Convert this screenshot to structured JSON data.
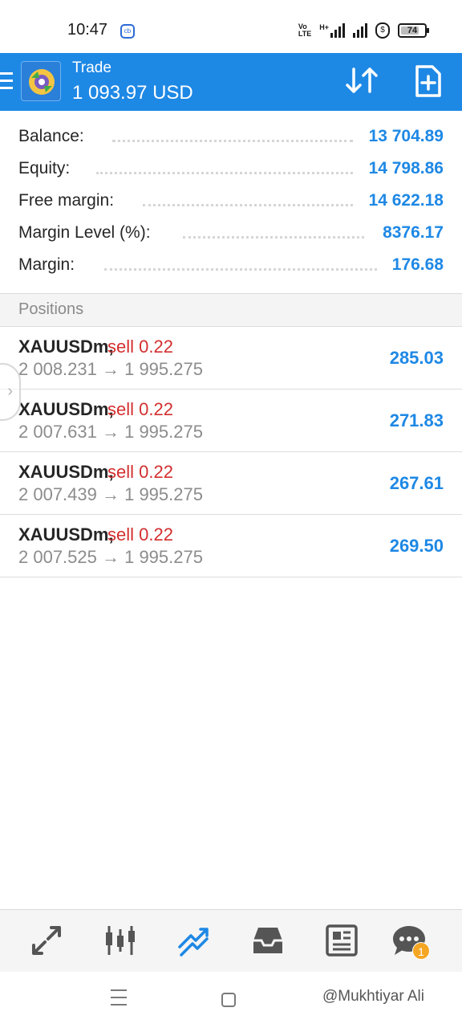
{
  "status_bar": {
    "time": "10:47",
    "badge": "cb",
    "network_label_top": "Vo",
    "network_label_bottom": "LTE",
    "network_type": "H+",
    "battery": "74"
  },
  "app_bar": {
    "title": "Trade",
    "subtitle": "1 093.97 USD",
    "accent_color": "#1e88e5"
  },
  "summary": [
    {
      "label": "Balance:",
      "value": "13 704.89"
    },
    {
      "label": "Equity:",
      "value": "14 798.86"
    },
    {
      "label": "Free margin:",
      "value": "14 622.18"
    },
    {
      "label": "Margin Level (%):",
      "value": "8376.17"
    },
    {
      "label": "Margin:",
      "value": "176.68"
    }
  ],
  "positions_header": "Positions",
  "positions": [
    {
      "symbol": "XAUUSDm,",
      "side": "sell 0.22",
      "prices": "2 008.231 → 1 995.275",
      "profit": "285.03"
    },
    {
      "symbol": "XAUUSDm,",
      "side": "sell 0.22",
      "prices": "2 007.631 → 1 995.275",
      "profit": "271.83"
    },
    {
      "symbol": "XAUUSDm,",
      "side": "sell 0.22",
      "prices": "2 007.439 → 1 995.275",
      "profit": "267.61"
    },
    {
      "symbol": "XAUUSDm,",
      "side": "sell 0.22",
      "prices": "2 007.525 → 1 995.275",
      "profit": "269.50"
    }
  ],
  "bottom_nav": {
    "items": [
      "quotes-icon",
      "chart-icon",
      "trade-icon",
      "history-icon",
      "news-icon",
      "chat-icon"
    ],
    "active": "trade-icon",
    "chat_badge": "1"
  },
  "watermark": "@Mukhtiyar Ali"
}
